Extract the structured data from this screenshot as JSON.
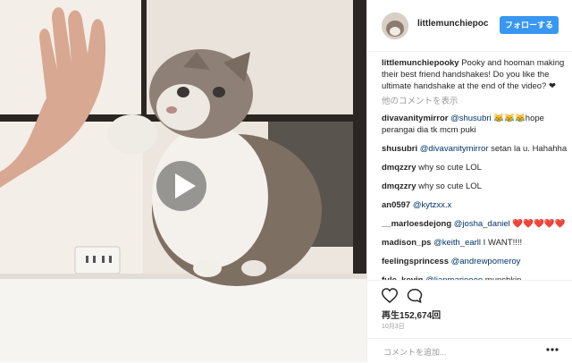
{
  "post": {
    "username": "littlemunchiepoc",
    "follow_label": "フォローする",
    "caption_user": "littlemunchiepooky",
    "caption_text": " Pooky and hooman making their best friend handshakes! Do you like the ultimate handshake at the end of the video? ❤",
    "load_more": "他のコメントを表示",
    "comments": [
      {
        "user": "divavanitymirror",
        "mention": "@shusubri",
        "text": " 😹😹😹hope perangai dia tk mcm puki"
      },
      {
        "user": "shusubri",
        "mention": "@divavanitymirror",
        "text": " setan la u. Hahahha"
      },
      {
        "user": "dmqzzry",
        "mention": "",
        "text": " why so cute LOL"
      },
      {
        "user": "dmqzzry",
        "mention": "",
        "text": " why so cute LOL"
      },
      {
        "user": "an0597",
        "mention": "@kytzxx.x",
        "text": ""
      },
      {
        "user": "__marloesdejong",
        "mention": "@josha_daniel",
        "text": " ❤️❤️❤️❤️❤️"
      },
      {
        "user": "madison_ps",
        "mention": "@keith_earll",
        "text": " I WANT!!!!"
      },
      {
        "user": "feelingsprincess",
        "mention": "@andrewpomeroy",
        "text": ""
      },
      {
        "user": "fule_kevin",
        "mention": "@lianmarieeee",
        "text": " munchkin.."
      }
    ],
    "views": "再生152,674回",
    "date": "10月3日",
    "comment_placeholder": "コメントを追加...",
    "icons": {
      "heart": "heart-icon",
      "comment": "comment-icon",
      "more": "more-options-icon",
      "play": "play-icon"
    },
    "colors": {
      "accent": "#3897f0",
      "mention": "#003569",
      "muted": "#999999"
    }
  }
}
